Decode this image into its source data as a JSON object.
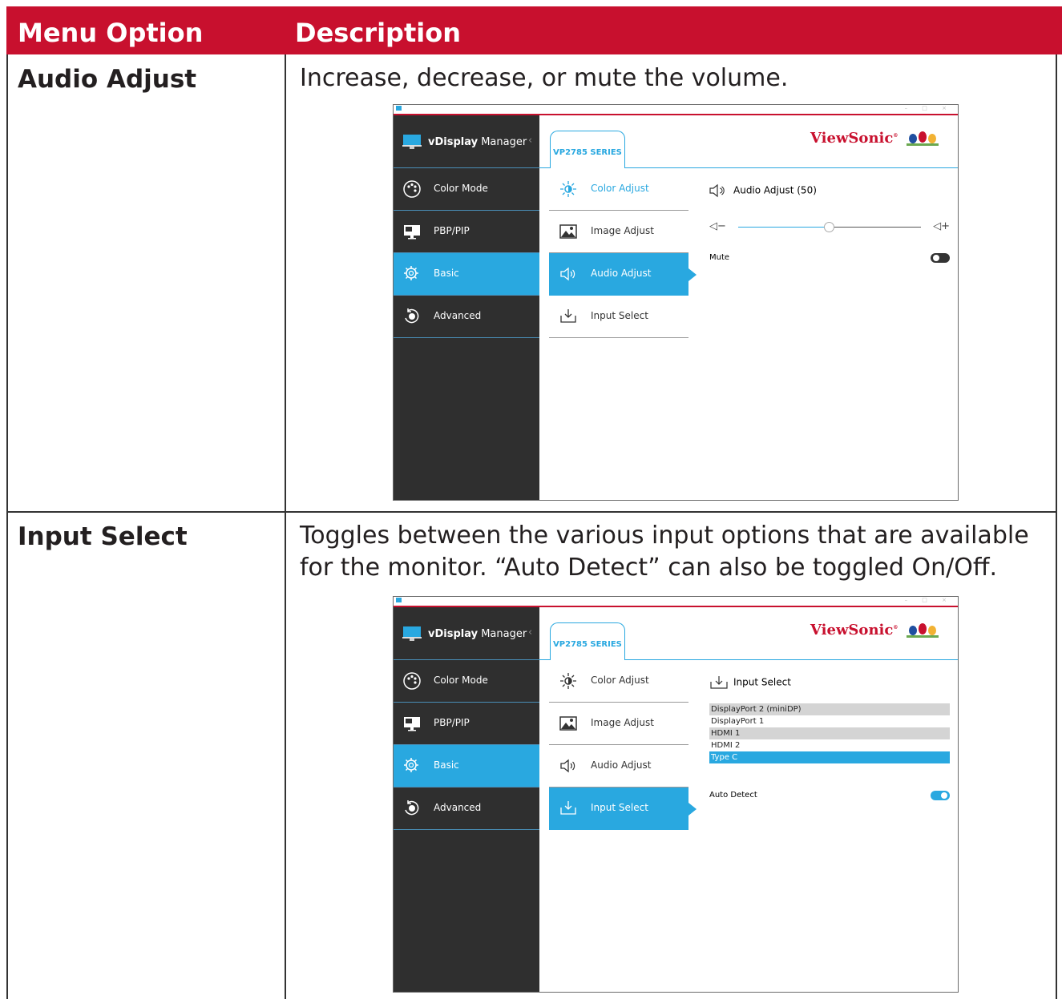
{
  "table": {
    "header_option": "Menu Option",
    "header_description": "Description"
  },
  "rows": [
    {
      "option": "Audio Adjust",
      "description": "Increase, decrease, or mute the volume."
    },
    {
      "option": "Input Select",
      "description": "Toggles between the various input options that are available for the monitor. “Auto Detect” can also be toggled On/Off."
    }
  ],
  "app": {
    "brand_bold": "vDisplay",
    "brand_rest": " Manager",
    "tab_label": "VP2785 SERIES",
    "logo_text": "ViewSonic",
    "logo_mark": "®",
    "sidebar": [
      "Color Mode",
      "PBP/PIP",
      "Basic",
      "Advanced"
    ],
    "menu": [
      "Color Adjust",
      "Image Adjust",
      "Audio Adjust",
      "Input Select"
    ],
    "colors": {
      "brand_red": "#c8102e",
      "accent_blue": "#29a8e0",
      "sidebar_dark": "#2f2f2f"
    }
  },
  "audio_panel": {
    "title": "Audio Adjust (50)",
    "volume": 50,
    "minus": "−",
    "plus": "+",
    "mute_label": "Mute",
    "mute_on": false
  },
  "input_panel": {
    "title": "Input Select",
    "options": [
      "DisplayPort 2 (miniDP)",
      "DisplayPort 1",
      "HDMI 1",
      "HDMI 2",
      "Type C"
    ],
    "selected": "Type C",
    "auto_detect_label": "Auto Detect",
    "auto_detect_on": true
  }
}
